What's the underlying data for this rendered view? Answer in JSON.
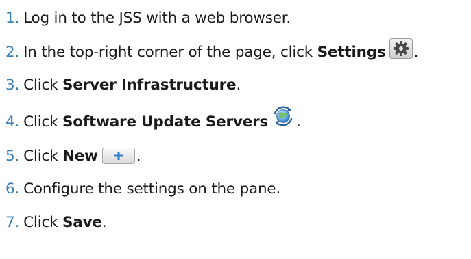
{
  "steps": [
    {
      "num": "1.",
      "text": "Log in to the JSS with a web browser."
    },
    {
      "num": "2.",
      "text_before": "In the top-right corner of the page, click ",
      "bold": "Settings",
      "text_after": "."
    },
    {
      "num": "3.",
      "text_before": "Click ",
      "bold": "Server Infrastructure",
      "text_after": "."
    },
    {
      "num": "4.",
      "text_before": "Click ",
      "bold": "Software Update Servers",
      "text_after": "."
    },
    {
      "num": "5.",
      "text_before": "Click ",
      "bold": "New",
      "text_after": "."
    },
    {
      "num": "6.",
      "text": "Configure the settings on the pane."
    },
    {
      "num": "7.",
      "text_before": "Click ",
      "bold": "Save",
      "text_after": "."
    }
  ],
  "icons": {
    "settings": "gear-icon",
    "software_update_servers": "globe-refresh-icon",
    "new": "plus-icon"
  },
  "colors": {
    "step_number": "#3a7fb8",
    "text": "#1a1a1a"
  }
}
